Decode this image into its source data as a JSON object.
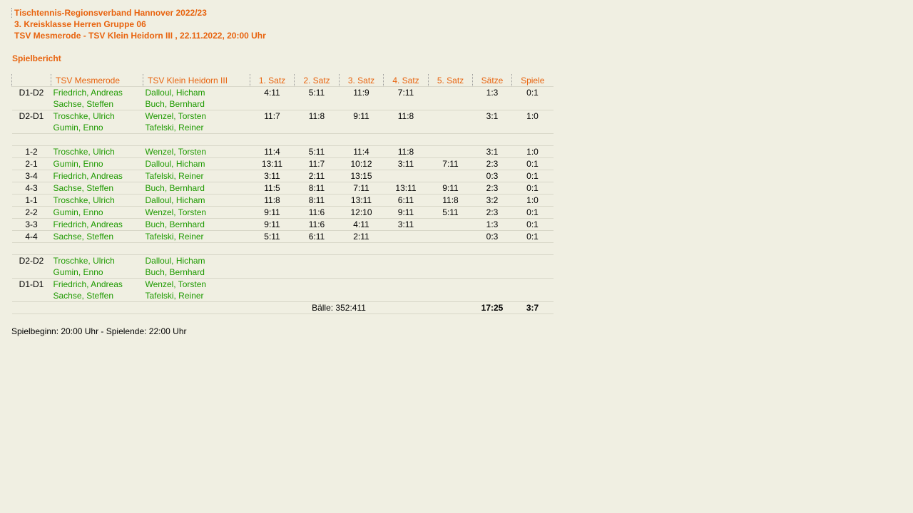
{
  "header": {
    "league": "Tischtennis-Regionsverband Hannover 2022/23",
    "group": "3. Kreisklasse Herren Gruppe 06",
    "match": "TSV Mesmerode - TSV Klein Heidorn III , 22.11.2022, 20:00 Uhr",
    "report_title": "Spielbericht"
  },
  "table": {
    "columns": [
      "",
      "TSV Mesmerode",
      "TSV Klein Heidorn III",
      "1. Satz",
      "2. Satz",
      "3. Satz",
      "4. Satz",
      "5. Satz",
      "Sätze",
      "Spiele"
    ],
    "doubles_top": [
      {
        "nr": "D1-D2",
        "home": [
          "Friedrich, Andreas",
          "Sachse, Steffen"
        ],
        "away": [
          "Dalloul, Hicham",
          "Buch, Bernhard"
        ],
        "sets": [
          "4:11",
          "5:11",
          "11:9",
          "7:11",
          ""
        ],
        "saetze": "1:3",
        "spiele": "0:1"
      },
      {
        "nr": "D2-D1",
        "home": [
          "Troschke, Ulrich",
          "Gumin, Enno"
        ],
        "away": [
          "Wenzel, Torsten",
          "Tafelski, Reiner"
        ],
        "sets": [
          "11:7",
          "11:8",
          "9:11",
          "11:8",
          ""
        ],
        "saetze": "3:1",
        "spiele": "1:0"
      }
    ],
    "singles": [
      {
        "nr": "1-2",
        "home": "Troschke, Ulrich",
        "away": "Wenzel, Torsten",
        "sets": [
          "11:4",
          "5:11",
          "11:4",
          "11:8",
          ""
        ],
        "saetze": "3:1",
        "spiele": "1:0"
      },
      {
        "nr": "2-1",
        "home": "Gumin, Enno",
        "away": "Dalloul, Hicham",
        "sets": [
          "13:11",
          "11:7",
          "10:12",
          "3:11",
          "7:11"
        ],
        "saetze": "2:3",
        "spiele": "0:1"
      },
      {
        "nr": "3-4",
        "home": "Friedrich, Andreas",
        "away": "Tafelski, Reiner",
        "sets": [
          "3:11",
          "2:11",
          "13:15",
          "",
          ""
        ],
        "saetze": "0:3",
        "spiele": "0:1"
      },
      {
        "nr": "4-3",
        "home": "Sachse, Steffen",
        "away": "Buch, Bernhard",
        "sets": [
          "11:5",
          "8:11",
          "7:11",
          "13:11",
          "9:11"
        ],
        "saetze": "2:3",
        "spiele": "0:1"
      },
      {
        "nr": "1-1",
        "home": "Troschke, Ulrich",
        "away": "Dalloul, Hicham",
        "sets": [
          "11:8",
          "8:11",
          "13:11",
          "6:11",
          "11:8"
        ],
        "saetze": "3:2",
        "spiele": "1:0"
      },
      {
        "nr": "2-2",
        "home": "Gumin, Enno",
        "away": "Wenzel, Torsten",
        "sets": [
          "9:11",
          "11:6",
          "12:10",
          "9:11",
          "5:11"
        ],
        "saetze": "2:3",
        "spiele": "0:1"
      },
      {
        "nr": "3-3",
        "home": "Friedrich, Andreas",
        "away": "Buch, Bernhard",
        "sets": [
          "9:11",
          "11:6",
          "4:11",
          "3:11",
          ""
        ],
        "saetze": "1:3",
        "spiele": "0:1"
      },
      {
        "nr": "4-4",
        "home": "Sachse, Steffen",
        "away": "Tafelski, Reiner",
        "sets": [
          "5:11",
          "6:11",
          "2:11",
          "",
          ""
        ],
        "saetze": "0:3",
        "spiele": "0:1"
      }
    ],
    "doubles_bottom": [
      {
        "nr": "D2-D2",
        "home": [
          "Troschke, Ulrich",
          "Gumin, Enno"
        ],
        "away": [
          "Dalloul, Hicham",
          "Buch, Bernhard"
        ]
      },
      {
        "nr": "D1-D1",
        "home": [
          "Friedrich, Andreas",
          "Sachse, Steffen"
        ],
        "away": [
          "Wenzel, Torsten",
          "Tafelski, Reiner"
        ]
      }
    ],
    "totals": {
      "balls": "Bälle: 352:411",
      "saetze": "17:25",
      "spiele": "3:7"
    }
  },
  "footer": "Spielbeginn: 20:00 Uhr - Spielende: 22:00 Uhr",
  "colors": {
    "accent": "#e8630e",
    "player": "#1e9a00",
    "background": "#f0efe2"
  }
}
